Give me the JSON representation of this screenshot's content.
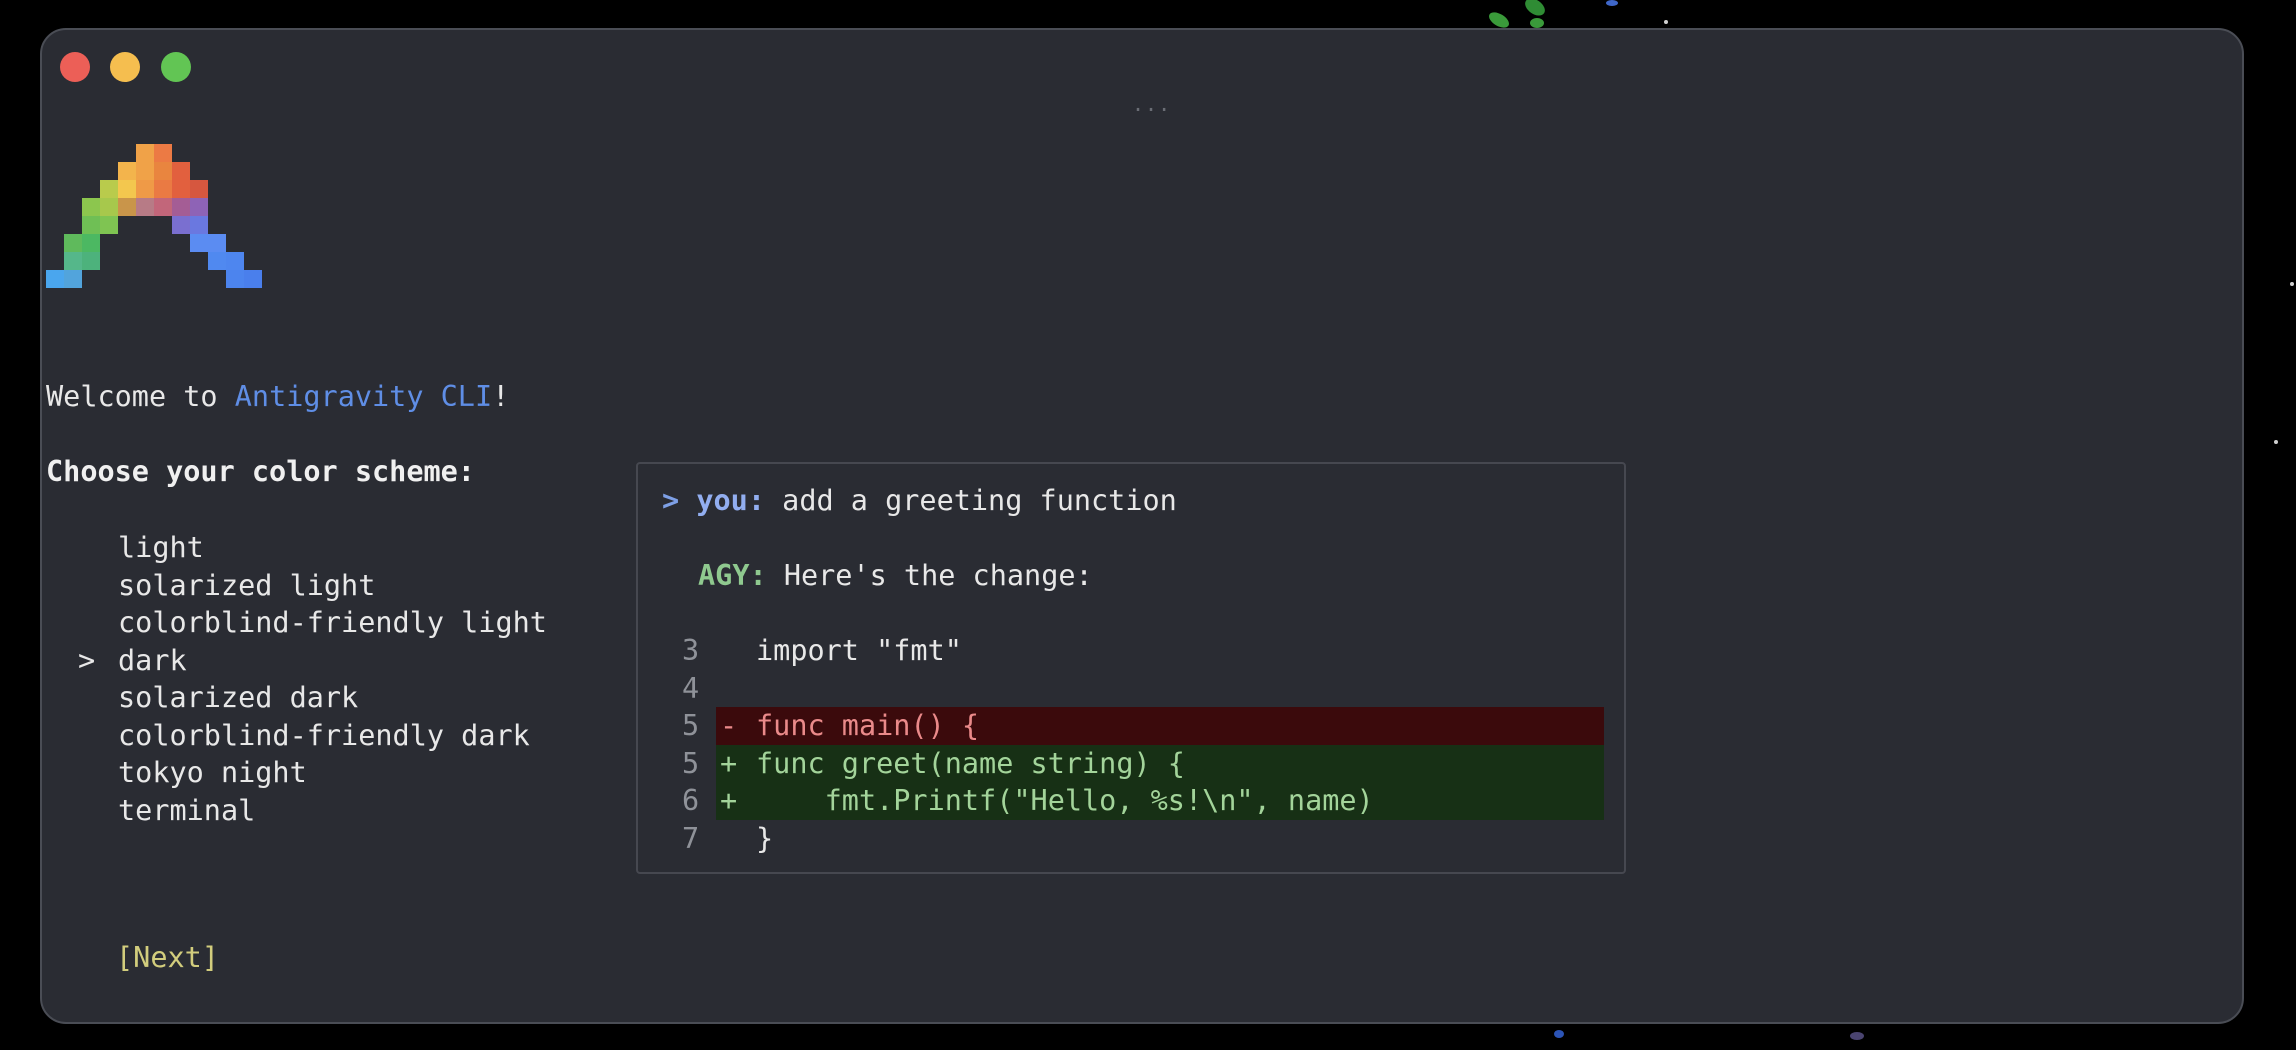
{
  "window": {
    "controls": [
      {
        "name": "close-icon",
        "color": "#ec5f57"
      },
      {
        "name": "minimize-icon",
        "color": "#f5be4f"
      },
      {
        "name": "maximize-icon",
        "color": "#62c554"
      }
    ],
    "drag_handle": "..."
  },
  "logo": {
    "icon": "antigravity-pixel-logo-icon",
    "colors": [
      "#e2603e",
      "#f09a48",
      "#f3c74e",
      "#8cc64e",
      "#4cb862",
      "#8e63b6",
      "#5b8cf2",
      "#4aa6ee"
    ]
  },
  "welcome": {
    "prefix": "Welcome to ",
    "product": "Antigravity CLI",
    "suffix": "!",
    "accent_color": "#5f8ee6"
  },
  "heading": "Choose your color scheme:",
  "color_schemes": [
    {
      "label": "light",
      "marker": ""
    },
    {
      "label": "solarized light",
      "marker": ""
    },
    {
      "label": "colorblind-friendly light",
      "marker": ""
    },
    {
      "label": "dark",
      "marker": ">"
    },
    {
      "label": "solarized dark",
      "marker": ""
    },
    {
      "label": "colorblind-friendly dark",
      "marker": ""
    },
    {
      "label": "tokyo night",
      "marker": ""
    },
    {
      "label": "terminal",
      "marker": ""
    }
  ],
  "selected_scheme": "dark",
  "next_button": "[Next]",
  "preview": {
    "prompt_caret": ">",
    "user_label": "you:",
    "user_message": "add a greeting function",
    "agent_label": "AGY:",
    "agent_message": "Here's the change:",
    "diff": [
      {
        "line": "3",
        "sign": "",
        "code": "import \"fmt\"",
        "kind": "ctx"
      },
      {
        "line": "4",
        "sign": "",
        "code": "",
        "kind": "ctx"
      },
      {
        "line": "5",
        "sign": "-",
        "code": "func main() {",
        "kind": "del"
      },
      {
        "line": "5",
        "sign": "+",
        "code": "func greet(name string) {",
        "kind": "add"
      },
      {
        "line": "6",
        "sign": "+",
        "code": "    fmt.Printf(\"Hello, %s!\\n\", name)",
        "kind": "add"
      },
      {
        "line": "7",
        "sign": "",
        "code": "}",
        "kind": "ctx"
      }
    ],
    "colors": {
      "removed_bg": "#3b0a0c",
      "removed_text": "#ea8a8a",
      "added_bg": "#173015",
      "added_text": "#a3d49a"
    }
  }
}
